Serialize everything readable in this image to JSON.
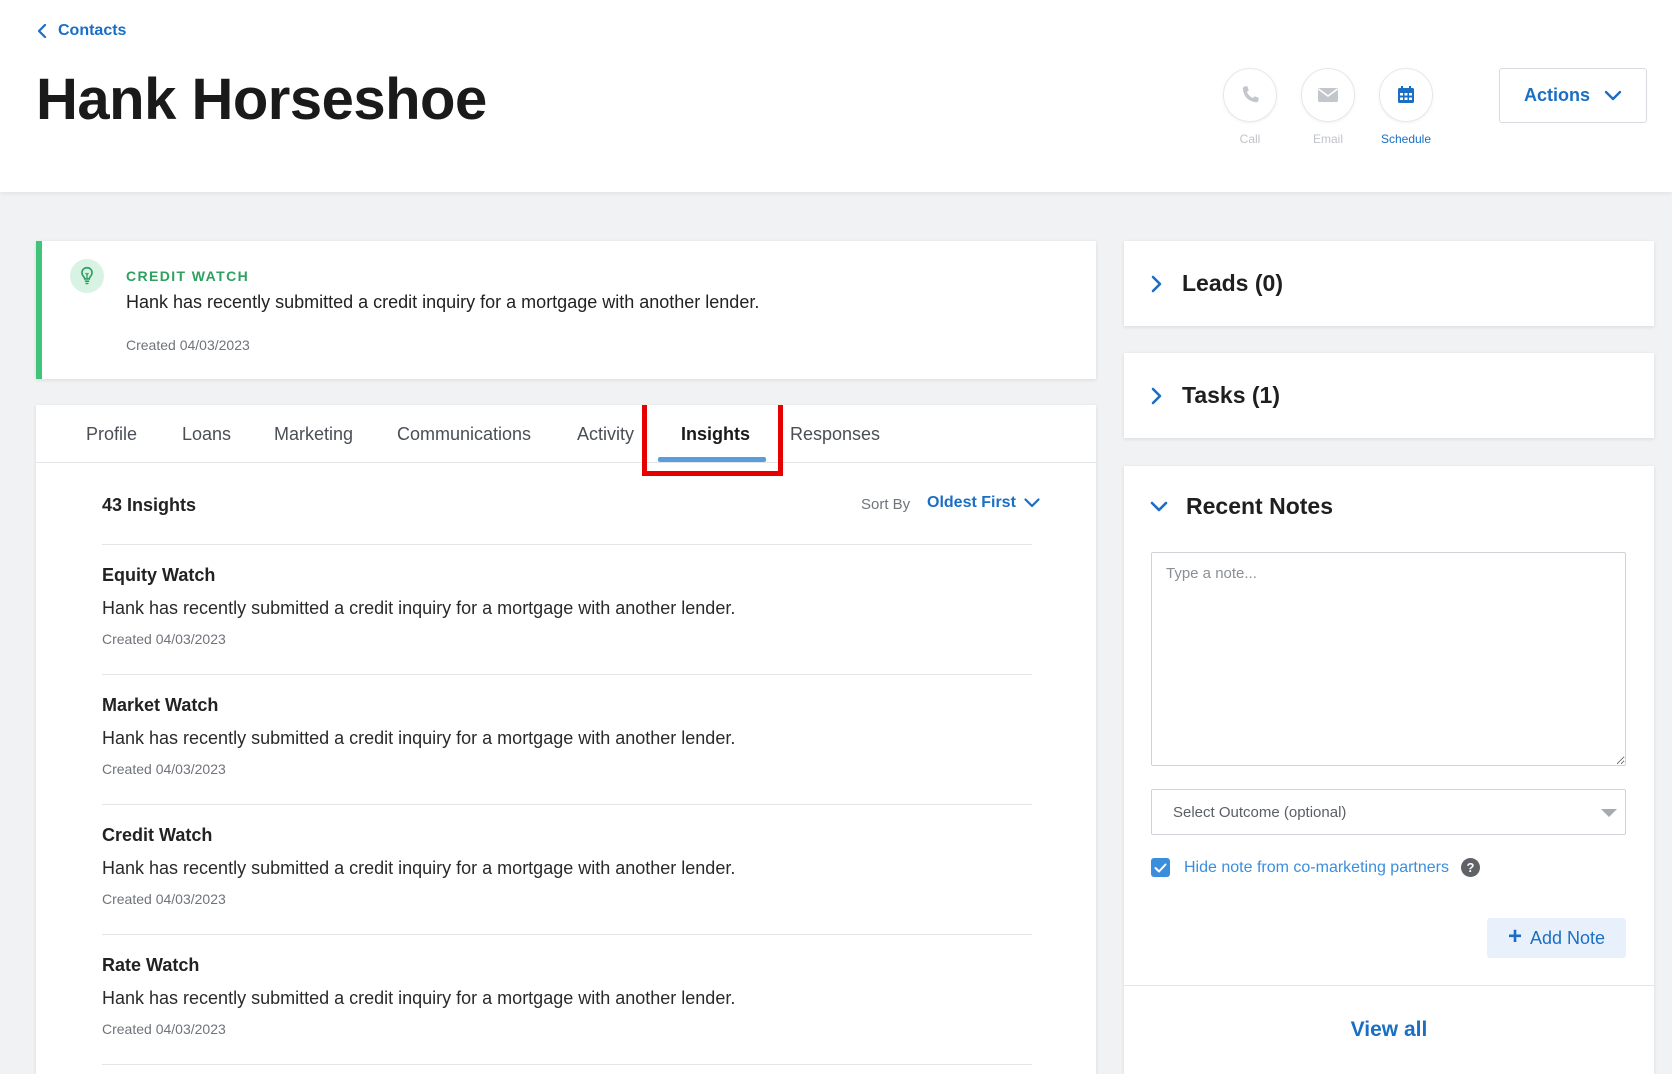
{
  "header": {
    "back_label": "Contacts",
    "contact_name": "Hank Horseshoe",
    "quick_actions": [
      {
        "label": "Call",
        "icon": "phone-icon"
      },
      {
        "label": "Email",
        "icon": "email-icon"
      },
      {
        "label": "Schedule",
        "icon": "calendar-icon"
      }
    ],
    "actions_label": "Actions"
  },
  "banner": {
    "eyebrow": "CREDIT WATCH",
    "text": "Hank has recently submitted a credit inquiry for a mortgage with another lender.",
    "created": "Created 04/03/2023",
    "icon": "lightbulb-icon",
    "accent_color": "#3fc47a"
  },
  "tabs": [
    {
      "label": "Profile"
    },
    {
      "label": "Loans"
    },
    {
      "label": "Marketing"
    },
    {
      "label": "Communications"
    },
    {
      "label": "Activity"
    },
    {
      "label": "Insights",
      "active": true
    },
    {
      "label": "Responses"
    }
  ],
  "insights": {
    "count_label": "43 Insights",
    "sort_label": "Sort By",
    "sort_value": "Oldest First",
    "items": [
      {
        "title": "Equity Watch",
        "text": "Hank has recently submitted a credit inquiry for a mortgage with another lender.",
        "created": "Created 04/03/2023"
      },
      {
        "title": "Market Watch",
        "text": "Hank has recently submitted a credit inquiry for a mortgage with another lender.",
        "created": "Created 04/03/2023"
      },
      {
        "title": "Credit Watch",
        "text": "Hank has recently submitted a credit inquiry for a mortgage with another lender.",
        "created": "Created 04/03/2023"
      },
      {
        "title": "Rate Watch",
        "text": "Hank has recently submitted a credit inquiry for a mortgage with another lender.",
        "created": "Created 04/03/2023"
      }
    ]
  },
  "sidebar": {
    "leads_label": "Leads (0)",
    "tasks_label": "Tasks (1)",
    "notes": {
      "title": "Recent Notes",
      "placeholder": "Type a note...",
      "outcome_placeholder": "Select Outcome (optional)",
      "hide_label": "Hide note from co-marketing partners",
      "hide_checked": true,
      "help_glyph": "?",
      "add_label": "Add Note",
      "view_all_label": "View all"
    }
  },
  "colors": {
    "accent_blue": "#1a6fc4",
    "success_green": "#3fc47a",
    "highlight_red": "#e60000"
  }
}
